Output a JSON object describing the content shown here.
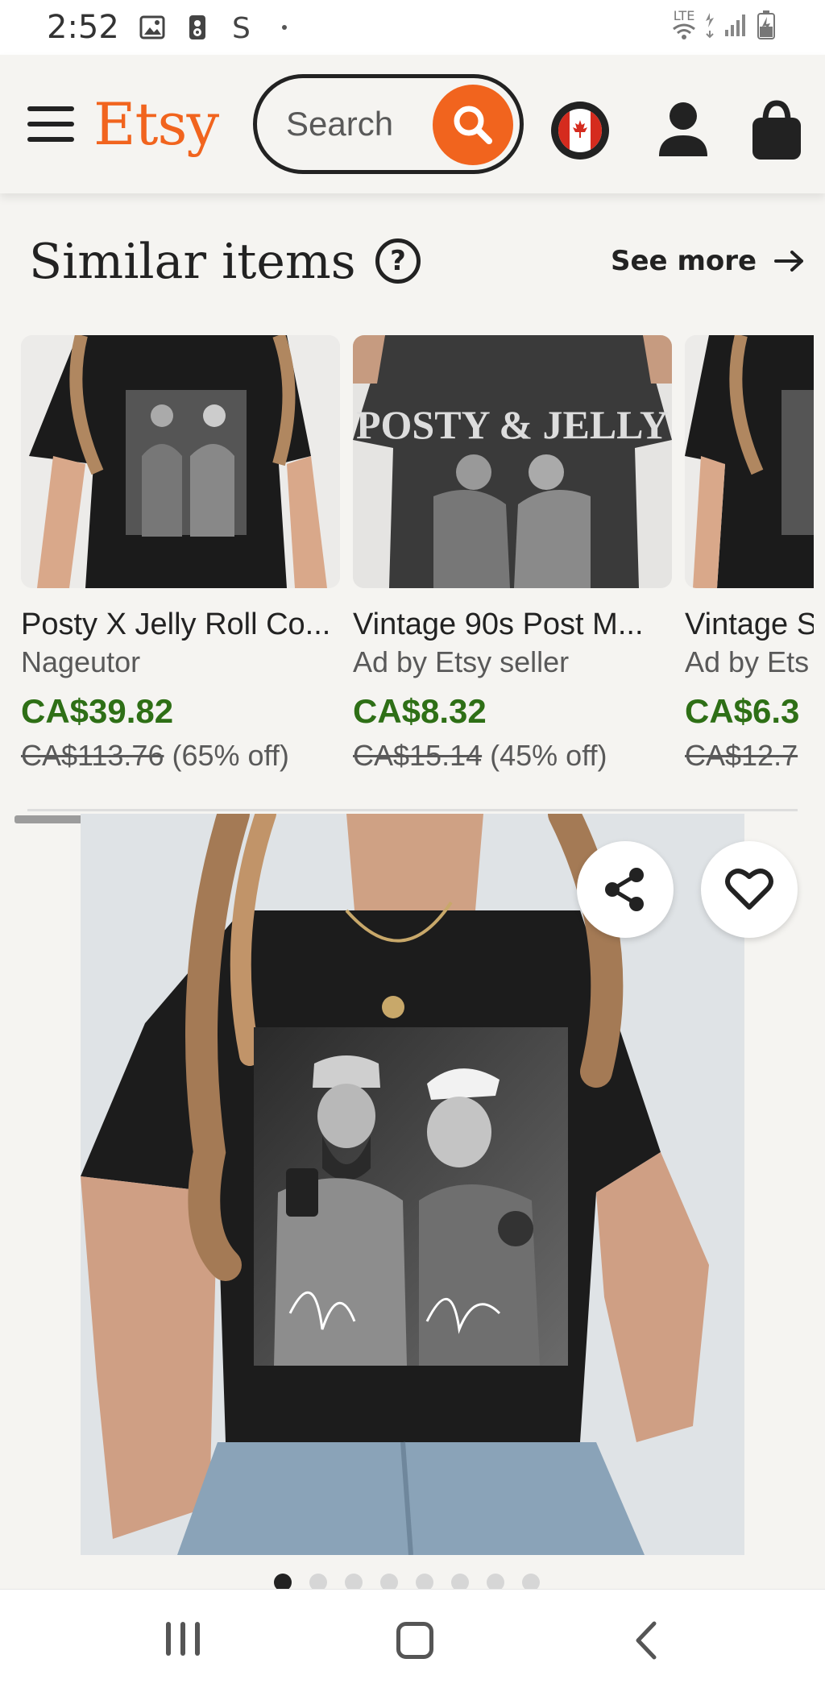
{
  "status_bar": {
    "time": "2:52",
    "network": "LTE"
  },
  "header": {
    "logo": "Etsy",
    "search": {
      "placeholder": "Search",
      "value": ""
    },
    "region_flag": "canada-flag-icon",
    "brand_color": "#f1641e"
  },
  "similar": {
    "title": "Similar items",
    "see_more": "See more",
    "items": [
      {
        "title": "Posty X Jelly Roll Co...",
        "seller": "Nageutor",
        "price": "CA$39.82",
        "original_price": "CA$113.76",
        "discount": "(65% off)"
      },
      {
        "title": "Vintage 90s Post M...",
        "seller": "Ad by Etsy seller",
        "price": "CA$8.32",
        "original_price": "CA$15.14",
        "discount": "(45% off)",
        "shirt_text": "POSTY & JELLY"
      },
      {
        "title": "Vintage S",
        "seller": "Ad by Ets",
        "price": "CA$6.3",
        "original_price": "CA$12.7",
        "discount": ""
      }
    ]
  },
  "main_listing": {
    "image_count": 8,
    "active_image": 1,
    "actions": [
      "share-icon",
      "heart-icon"
    ]
  },
  "price_color": "#2e6f16"
}
